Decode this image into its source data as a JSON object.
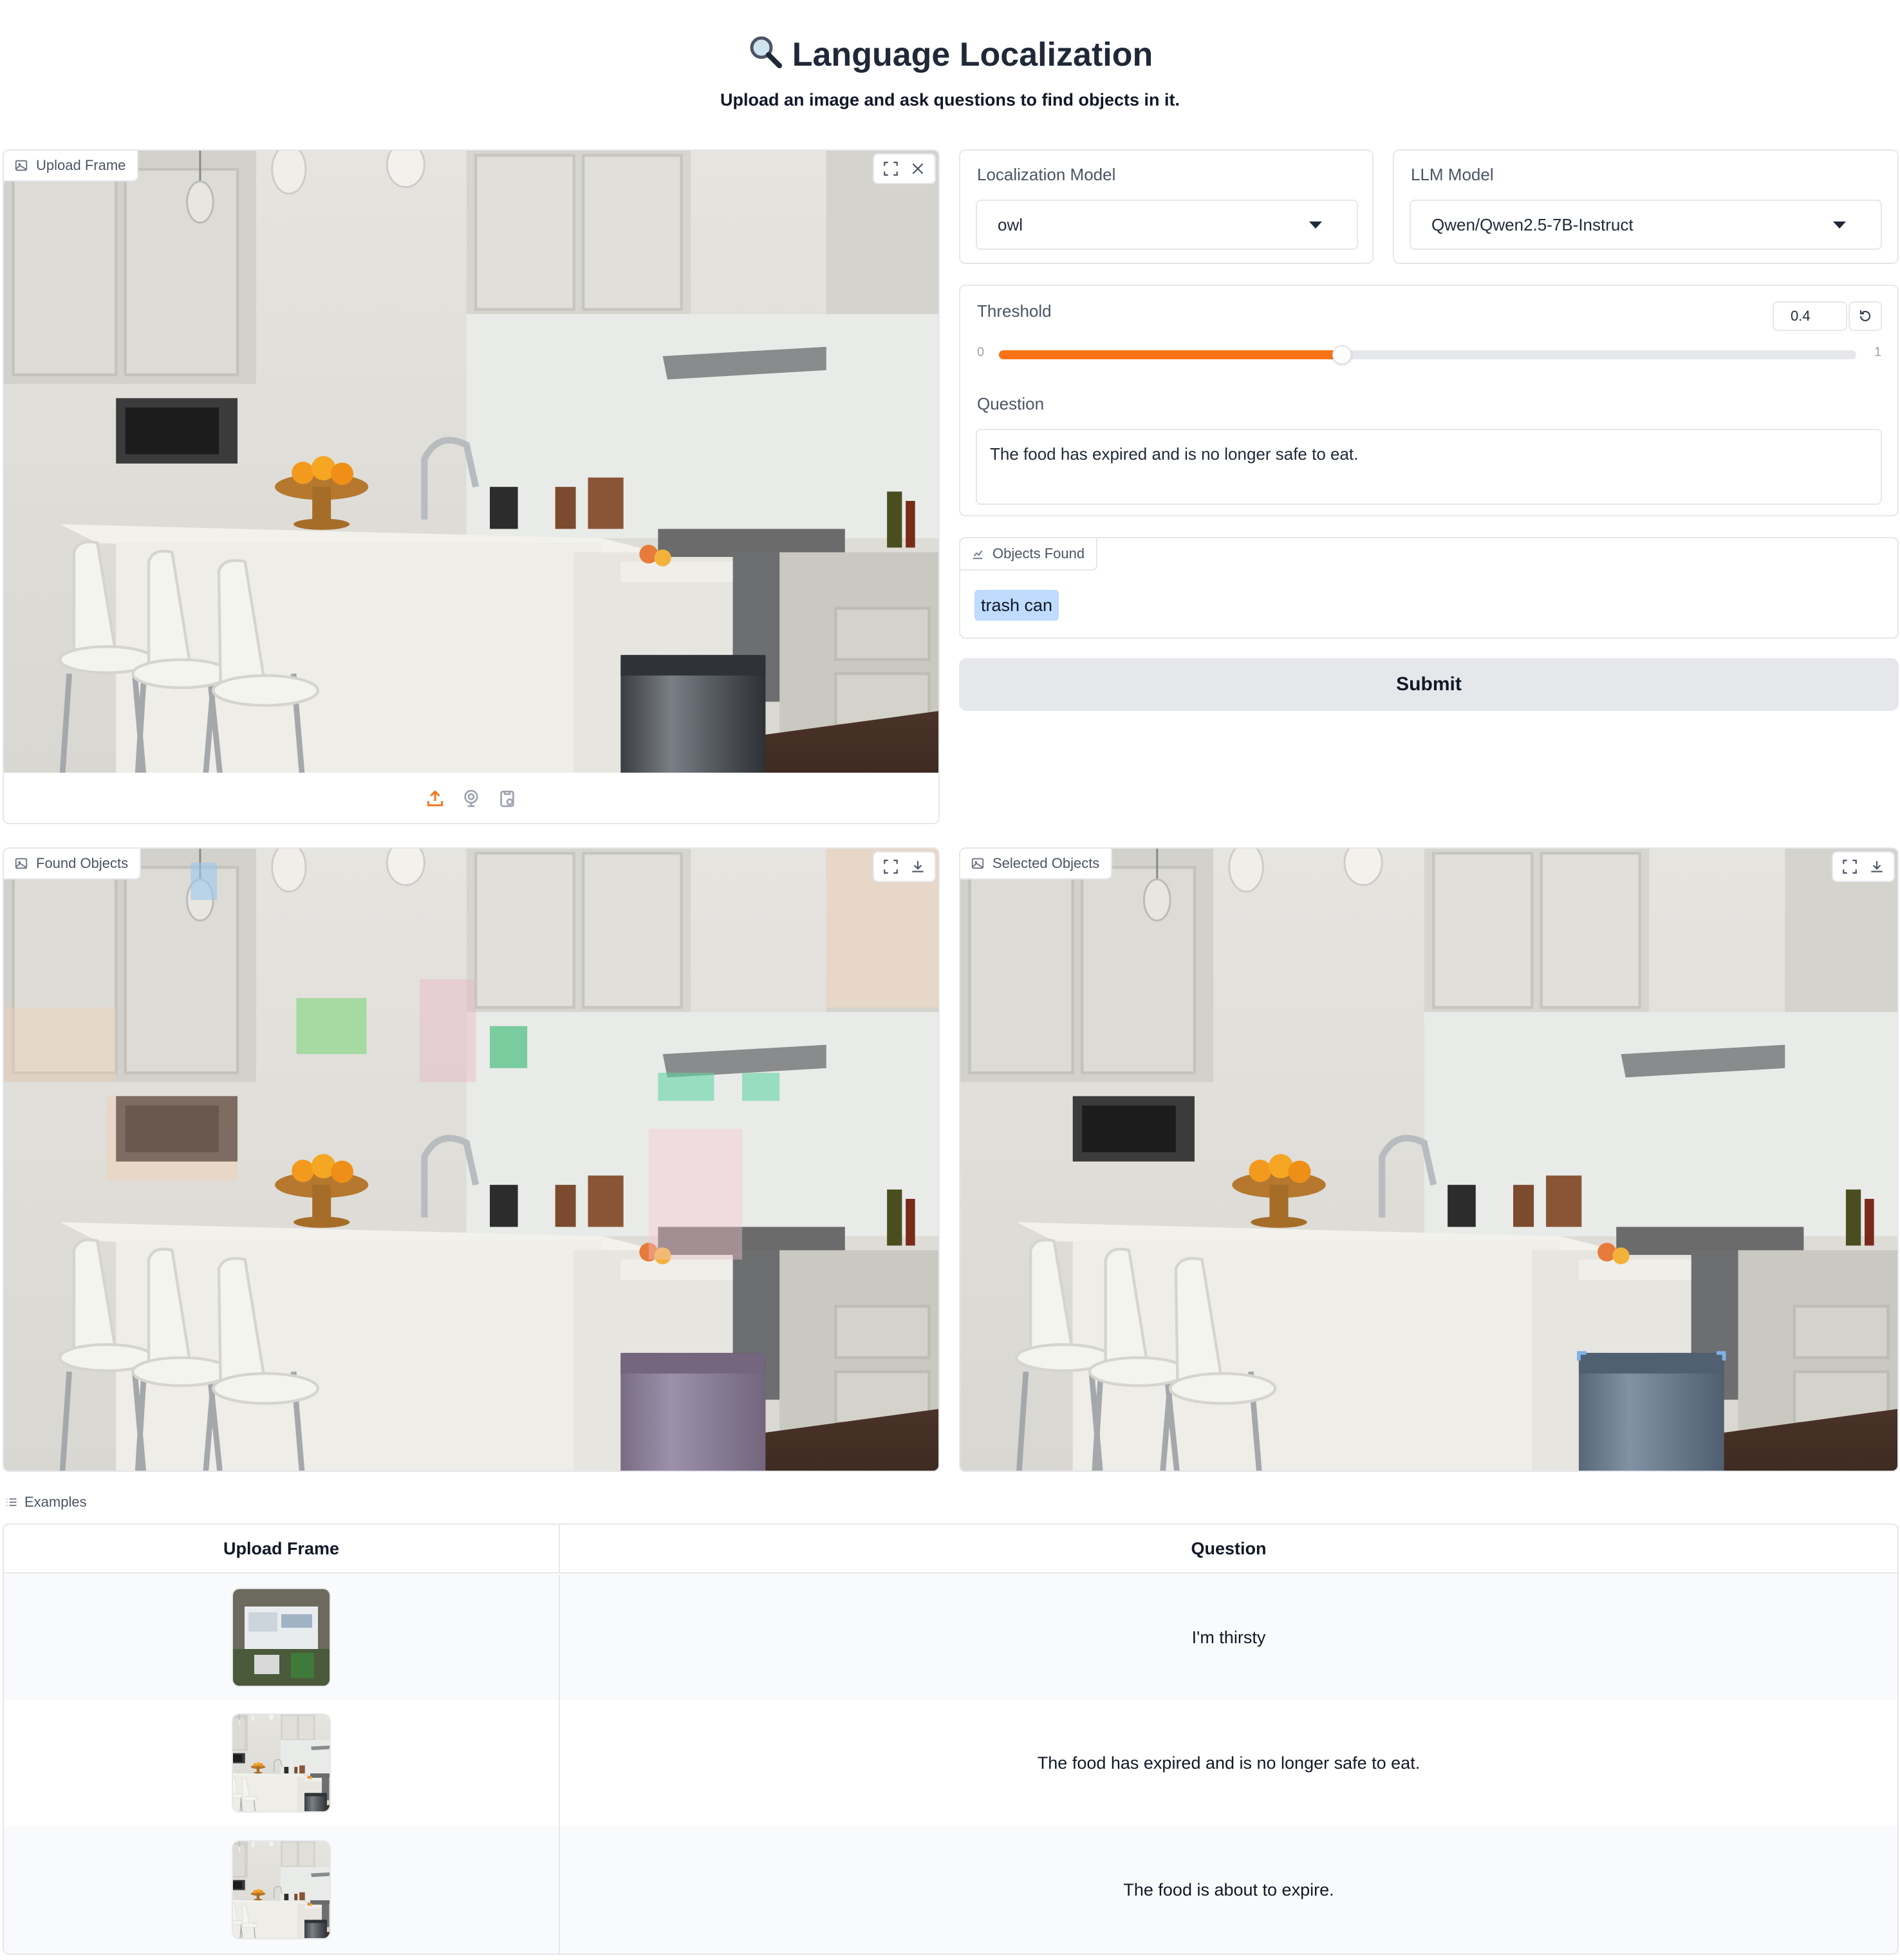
{
  "header": {
    "title": "Language Localization",
    "subtitle": "Upload an image and ask questions to find objects in it."
  },
  "upload_panel": {
    "label": "Upload Frame",
    "icons": [
      "fullscreen-icon",
      "close-icon",
      "upload-icon",
      "webcam-icon",
      "clipboard-icon"
    ]
  },
  "controls": {
    "localization_model": {
      "label": "Localization Model",
      "value": "owl"
    },
    "llm_model": {
      "label": "LLM Model",
      "value": "Qwen/Qwen2.5-7B-Instruct"
    },
    "threshold": {
      "label": "Threshold",
      "value": "0.4",
      "min": "0",
      "max": "1",
      "fraction": 0.4
    },
    "question": {
      "label": "Question",
      "value": "The food has expired and is no longer safe to eat."
    },
    "objects_found": {
      "label": "Objects Found",
      "items": [
        "trash can"
      ]
    },
    "submit_label": "Submit"
  },
  "found_panel": {
    "label": "Found Objects"
  },
  "selected_panel": {
    "label": "Selected Objects"
  },
  "examples": {
    "label": "Examples",
    "headers": [
      "Upload Frame",
      "Question"
    ],
    "rows": [
      {
        "question": "I'm thirsty"
      },
      {
        "question": "The food has expired and is no longer safe to eat."
      },
      {
        "question": "The food is about to expire."
      }
    ]
  },
  "colors": {
    "accent": "#f97316",
    "chip": "#bfdbfe",
    "border": "#e5e7eb"
  }
}
